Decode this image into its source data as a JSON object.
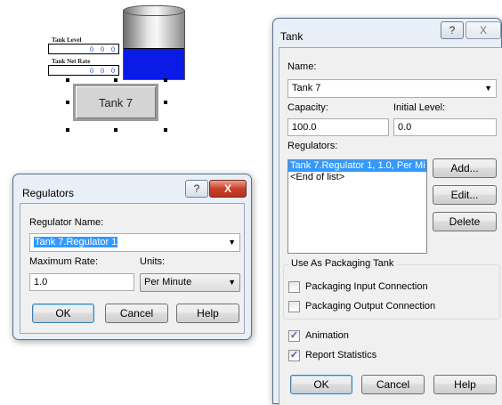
{
  "canvas": {
    "tank_level_label": "Tank Level",
    "tank_level_values": [
      "0",
      "0",
      "0"
    ],
    "tank_net_rate_label": "Tank Net Rate",
    "tank_net_rate_values": [
      "0",
      "0",
      "0"
    ],
    "tank_fill_fraction": 0.45,
    "tank_fill_color": "#0a1be8",
    "tank_button_label": "Tank 7"
  },
  "regulators_dialog": {
    "title": "Regulators",
    "help_icon": "?",
    "close_icon": "X",
    "regulator_name_label": "Regulator Name:",
    "regulator_name_value": "Tank 7.Regulator 1",
    "maximum_rate_label": "Maximum Rate:",
    "maximum_rate_value": "1.0",
    "units_label": "Units:",
    "units_value": "Per Minute",
    "ok_label": "OK",
    "cancel_label": "Cancel",
    "help_label": "Help"
  },
  "tank_dialog": {
    "title": "Tank",
    "help_icon": "?",
    "close_icon": "X",
    "name_label": "Name:",
    "name_value": "Tank 7",
    "capacity_label": "Capacity:",
    "capacity_value": "100.0",
    "initial_level_label": "Initial Level:",
    "initial_level_value": "0.0",
    "regulators_label": "Regulators:",
    "regulators_list": [
      "Tank 7.Regulator 1, 1.0, Per Mi",
      "<End of list>"
    ],
    "add_label": "Add...",
    "edit_label": "Edit...",
    "delete_label": "Delete",
    "packaging_group_title": "Use As Packaging Tank",
    "packaging_input_label": "Packaging Input Connection",
    "packaging_output_label": "Packaging Output Connection",
    "animation_label": "Animation",
    "report_statistics_label": "Report Statistics",
    "ok_label": "OK",
    "cancel_label": "Cancel",
    "help_label": "Help"
  },
  "colors": {
    "selection": "#3399ff",
    "dialog_frame": "#e9eff6",
    "close_button": "#c9402a"
  }
}
